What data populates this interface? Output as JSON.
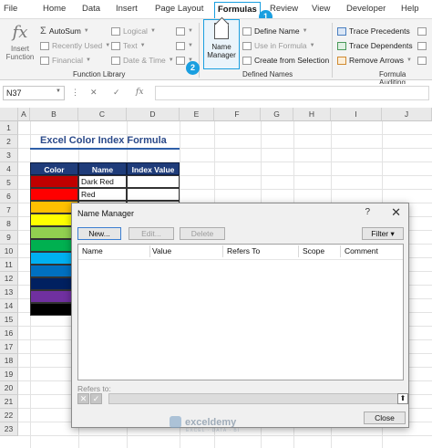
{
  "tabs": [
    "File",
    "Home",
    "Data",
    "Insert",
    "Page Layout",
    "Formulas",
    "Review",
    "View",
    "Developer",
    "Help"
  ],
  "active_tab": "Formulas",
  "callouts": [
    "1",
    "2"
  ],
  "ribbon": {
    "insert_function": "Insert Function",
    "function_library": {
      "autosum": "AutoSum",
      "recently_used": "Recently Used",
      "financial": "Financial",
      "logical": "Logical",
      "text": "Text",
      "date_time": "Date & Time",
      "label": "Function Library"
    },
    "defined_names": {
      "name_manager": "Name Manager",
      "define_name": "Define Name",
      "use_in_formula": "Use in Formula",
      "create_from_selection": "Create from Selection",
      "label": "Defined Names"
    },
    "formula_auditing": {
      "trace_precedents": "Trace Precedents",
      "trace_dependents": "Trace Dependents",
      "remove_arrows": "Remove Arrows",
      "label": "Formula Auditing"
    }
  },
  "formula_bar": {
    "name_box": "N37",
    "cancel": "✕",
    "enter": "✓",
    "fx": "fx",
    "value": ""
  },
  "sheet": {
    "columns": [
      "A",
      "B",
      "C",
      "D",
      "E",
      "F",
      "G",
      "H",
      "I",
      "J"
    ],
    "rows": [
      "1",
      "2",
      "3",
      "4",
      "5",
      "6",
      "7",
      "8",
      "9",
      "10",
      "11",
      "12",
      "13",
      "14",
      "15",
      "16",
      "17",
      "18",
      "19",
      "20",
      "21",
      "22",
      "23"
    ],
    "title": "Excel Color Index Formula",
    "table_headers": [
      "Color",
      "Name",
      "Index Value"
    ],
    "table_rows": [
      {
        "color": "#c00000",
        "name": "Dark Red",
        "index": ""
      },
      {
        "color": "#ff0000",
        "name": "Red",
        "index": ""
      },
      {
        "color": "#ffc000",
        "name": "",
        "index": ""
      },
      {
        "color": "#ffff00",
        "name": "",
        "index": ""
      },
      {
        "color": "#92d050",
        "name": "",
        "index": ""
      },
      {
        "color": "#00b050",
        "name": "",
        "index": ""
      },
      {
        "color": "#00b0f0",
        "name": "",
        "index": ""
      },
      {
        "color": "#0070c0",
        "name": "",
        "index": ""
      },
      {
        "color": "#002060",
        "name": "",
        "index": ""
      },
      {
        "color": "#7030a0",
        "name": "",
        "index": ""
      },
      {
        "color": "#000000",
        "name": "",
        "index": ""
      }
    ]
  },
  "dialog": {
    "title": "Name Manager",
    "help": "?",
    "close": "✕",
    "buttons": {
      "new": "New...",
      "edit": "Edit...",
      "delete": "Delete",
      "filter": "Filter ▾",
      "close": "Close"
    },
    "columns": [
      "Name",
      "Value",
      "Refers To",
      "Scope",
      "Comment"
    ],
    "refers_to_label": "Refers to:"
  },
  "watermark": {
    "name": "exceldemy",
    "tagline": "EXCEL · DATA · BI"
  }
}
